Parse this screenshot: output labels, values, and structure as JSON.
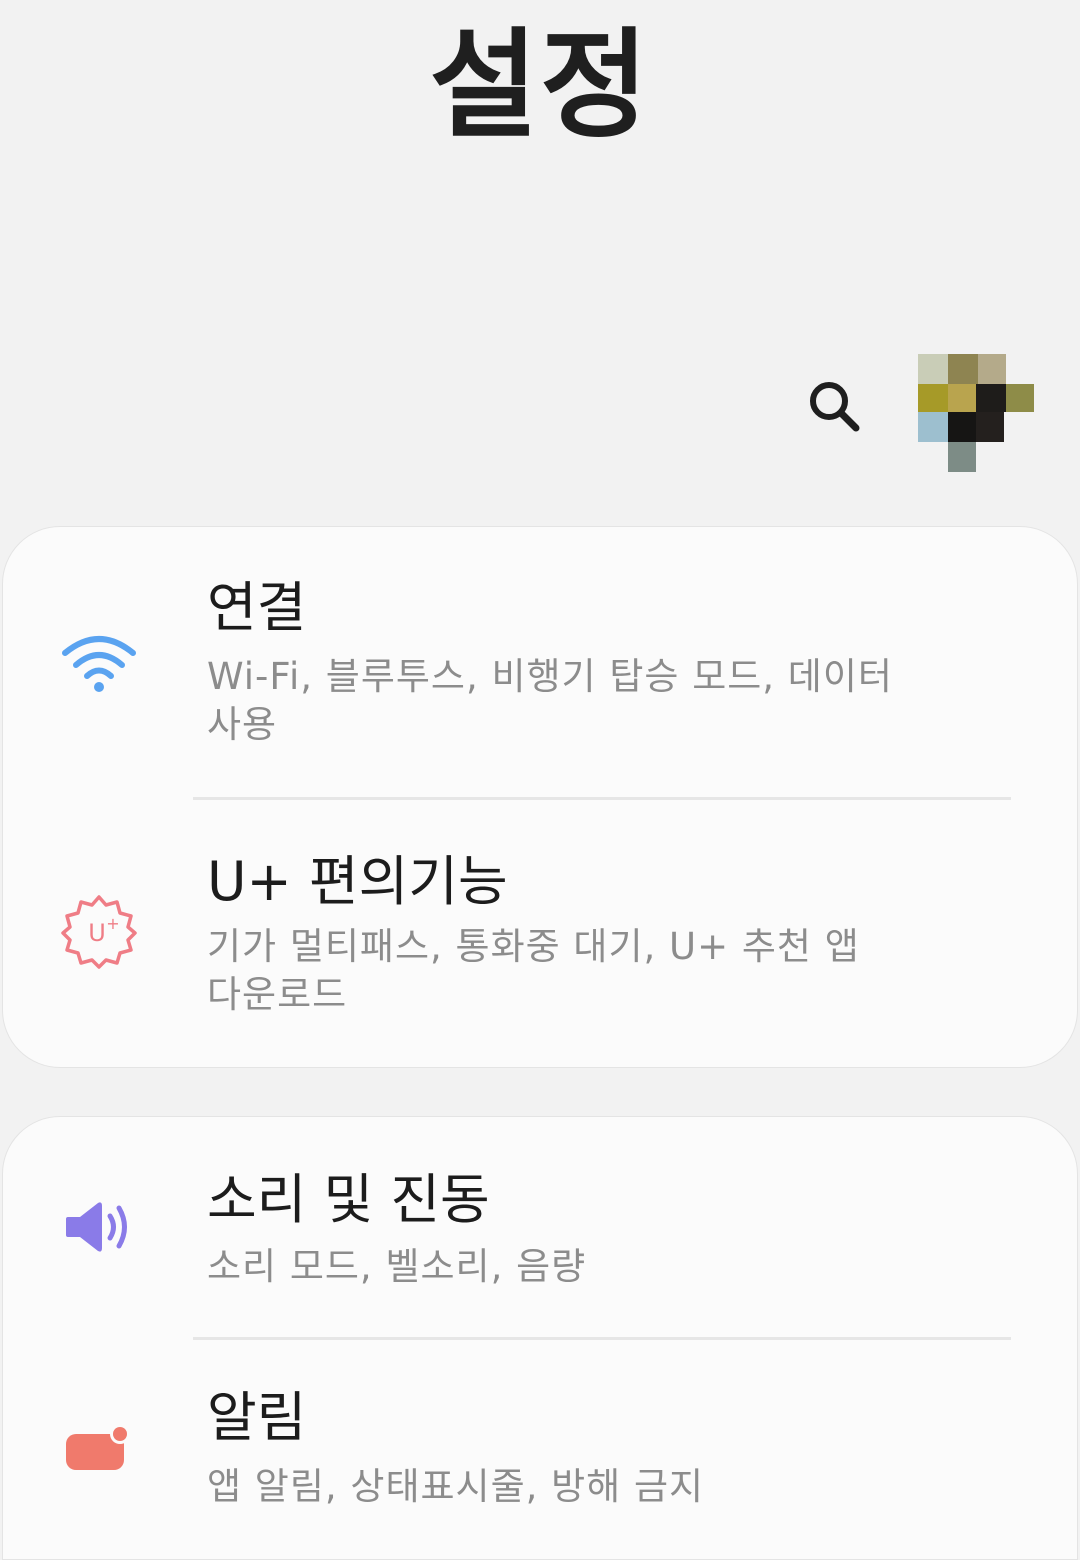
{
  "header": {
    "title": "설정",
    "search_icon": "search-icon",
    "avatar": "profile-avatar"
  },
  "cards": [
    {
      "items": [
        {
          "title": "연결",
          "subtitle": "Wi-Fi, 블루투스, 비행기 탑승 모드, 데이터 사용",
          "icon": "wifi-icon",
          "icon_color": "#5aa3f0"
        },
        {
          "title": "U+ 편의기능",
          "subtitle": "기가 멀티패스, 통화중 대기, U+ 추천 앱 다운로드",
          "icon": "uplus-gear-icon",
          "icon_color": "#ef7d86"
        }
      ]
    },
    {
      "items": [
        {
          "title": "소리 및 진동",
          "subtitle": "소리 모드, 벨소리, 음량",
          "icon": "speaker-icon",
          "icon_color": "#8a7be8"
        },
        {
          "title": "알림",
          "subtitle": "앱 알림, 상태표시줄, 방해 금지",
          "icon": "notification-icon",
          "icon_color": "#f07a6c"
        }
      ]
    }
  ],
  "colors": {
    "background": "#f2f2f2",
    "card": "#fbfbfb",
    "title_text": "#1c1c1c",
    "subtitle_text": "#8c8c8c"
  }
}
